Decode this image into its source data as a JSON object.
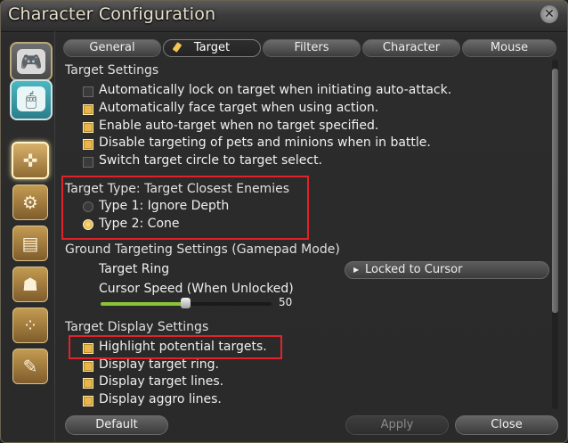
{
  "window": {
    "title": "Character Configuration",
    "close_glyph": "✕"
  },
  "sidebar": {
    "device_tabs": [
      {
        "name": "gamepad",
        "icon": "gamepad-icon",
        "glyph": "🎮",
        "selected": false
      },
      {
        "name": "mouse",
        "icon": "mouse-icon",
        "glyph": "🖱",
        "selected": true
      }
    ],
    "categories": [
      {
        "icon": "crossed-arrows-icon",
        "glyph": "✜",
        "selected": true
      },
      {
        "icon": "gears-bag-icon",
        "glyph": "⚙",
        "selected": false
      },
      {
        "icon": "id-card-icon",
        "glyph": "▤",
        "selected": false
      },
      {
        "icon": "character-icon",
        "glyph": "☗",
        "selected": false
      },
      {
        "icon": "dotted-path-icon",
        "glyph": "⁘",
        "selected": false
      },
      {
        "icon": "chat-bubble-icon",
        "glyph": "✎",
        "selected": false
      }
    ]
  },
  "tabs": [
    {
      "label": "General",
      "active": false
    },
    {
      "label": "Target",
      "active": true
    },
    {
      "label": "Filters",
      "active": false
    },
    {
      "label": "Character",
      "active": false
    },
    {
      "label": "Mouse",
      "active": false
    }
  ],
  "target_settings": {
    "heading": "Target Settings",
    "options": [
      {
        "label": "Automatically lock on target when initiating auto-attack.",
        "checked": false
      },
      {
        "label": "Automatically face target when using action.",
        "checked": true
      },
      {
        "label": "Enable auto-target when no target specified.",
        "checked": true
      },
      {
        "label": "Disable targeting of pets and minions when in battle.",
        "checked": true
      },
      {
        "label": "Switch target circle to target select.",
        "checked": false
      }
    ]
  },
  "target_type": {
    "heading": "Target Type: Target Closest Enemies",
    "options": [
      {
        "label": "Type 1: Ignore Depth",
        "selected": false
      },
      {
        "label": "Type 2: Cone",
        "selected": true
      }
    ]
  },
  "ground_targeting": {
    "heading": "Ground Targeting Settings (Gamepad Mode)",
    "target_ring_label": "Target Ring",
    "target_ring_value": "Locked to Cursor",
    "cursor_speed_label": "Cursor Speed (When Unlocked)",
    "cursor_speed_value": "50",
    "cursor_speed_fraction": 0.5
  },
  "target_display": {
    "heading": "Target Display Settings",
    "options": [
      {
        "label": "Highlight potential targets.",
        "checked": true
      },
      {
        "label": "Display target ring.",
        "checked": true
      },
      {
        "label": "Display target lines.",
        "checked": true
      },
      {
        "label": "Display aggro lines.",
        "checked": true
      }
    ]
  },
  "footer": {
    "default_label": "Default",
    "apply_label": "Apply",
    "close_label": "Close"
  },
  "colors": {
    "accent": "#e8b64a",
    "highlight": "#e0232b",
    "slider": "#8ac43a"
  }
}
